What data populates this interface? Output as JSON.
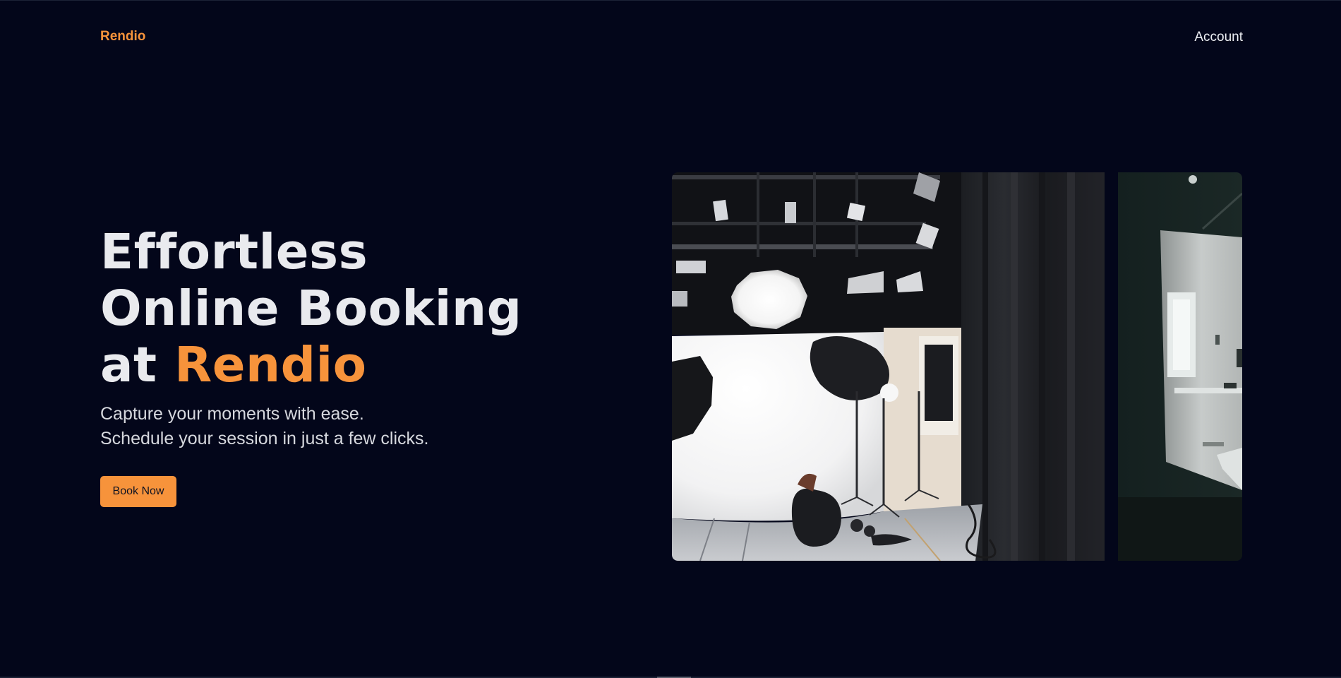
{
  "nav": {
    "brand": "Rendio",
    "account_label": "Account"
  },
  "hero": {
    "headline_line1": "Effortless",
    "headline_line2": "Online Booking",
    "headline_line3_prefix": "at",
    "headline_line3_accent": "Rendio",
    "subtitle_line1": "Capture your moments with ease.",
    "subtitle_line2": "Schedule your session in just a few clicks.",
    "cta_label": "Book Now"
  },
  "carousel": {
    "slides": [
      {
        "subject": "photo studio with lights, umbrellas and white backdrop"
      },
      {
        "subject": "studio room with white wall and dim lighting"
      }
    ]
  },
  "colors": {
    "background": "#03061a",
    "accent": "#f7933b",
    "text": "#e9eaee"
  }
}
